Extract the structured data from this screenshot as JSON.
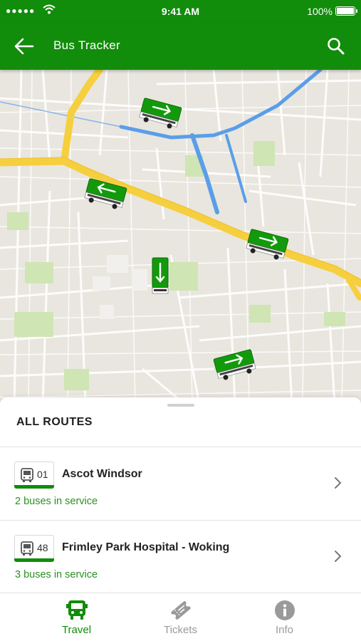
{
  "status_bar": {
    "signal": "●●●●●",
    "time": "9:41 AM",
    "battery": "100%"
  },
  "header": {
    "title": "Bus Tracker",
    "back_icon": "arrow-left-icon",
    "search_icon": "search-icon"
  },
  "map": {
    "buses": [
      {
        "direction": "right"
      },
      {
        "direction": "left"
      },
      {
        "direction": "right"
      },
      {
        "direction": "down"
      },
      {
        "direction": "right"
      }
    ],
    "colors": {
      "bus": "#139a0c",
      "road_major": "#f6cf3f",
      "water": "#5a9ee8",
      "park": "#cfe5b4"
    }
  },
  "routes_panel": {
    "title": "ALL ROUTES",
    "routes": [
      {
        "number": "01",
        "name": "Ascot Windsor",
        "status": "2 buses in service"
      },
      {
        "number": "48",
        "name": "Frimley Park Hospital - Woking",
        "status": "3 buses in service"
      }
    ]
  },
  "tabs": [
    {
      "label": "Travel",
      "icon": "bus-icon",
      "active": true
    },
    {
      "label": "Tickets",
      "icon": "ticket-icon",
      "active": false
    },
    {
      "label": "Info",
      "icon": "info-icon",
      "active": false
    }
  ],
  "colors": {
    "accent": "#128c0b",
    "status_green": "#2d8f23",
    "inactive": "#9a9a9a"
  }
}
